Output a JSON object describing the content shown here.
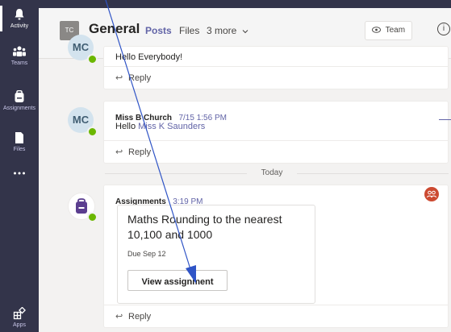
{
  "rail": {
    "items": [
      {
        "label": "Activity",
        "icon": "bell-icon",
        "active": true
      },
      {
        "label": "Teams",
        "icon": "teams-icon",
        "active": false
      },
      {
        "label": "Assignments",
        "icon": "backpack-icon",
        "active": false
      },
      {
        "label": "Files",
        "icon": "file-icon",
        "active": false
      },
      {
        "label": "",
        "icon": "more-dots-icon",
        "active": false
      },
      {
        "label": "Apps",
        "icon": "apps-icon",
        "active": false
      }
    ]
  },
  "header": {
    "team_initials": "TC",
    "channel": "General",
    "tabs": [
      "Posts",
      "Files",
      "3 more"
    ],
    "team_button": "Team",
    "info_glyph": "i"
  },
  "feed": {
    "post1": {
      "avatar_initials": "MC",
      "message": "Hello Everybody!",
      "reply": "Reply"
    },
    "post2": {
      "avatar_initials": "MC",
      "author": "Miss B Church",
      "time": "7/15 1:56 PM",
      "message_prefix": "Hello ",
      "mention": "Miss K Saunders",
      "reply": "Reply"
    },
    "divider": "Today",
    "post3": {
      "author": "Assignments",
      "time": "3:19 PM",
      "assignment_title": "Maths Rounding to the nearest 10,100 and 1000",
      "due": "Due Sep 12",
      "button": "View assignment",
      "reply": "Reply"
    }
  },
  "colors": {
    "rail": "#33344a",
    "accent": "#6264a7",
    "presence": "#6bb700",
    "reaction": "#cc4a31",
    "annotation_arrow": "#2f54c6"
  }
}
